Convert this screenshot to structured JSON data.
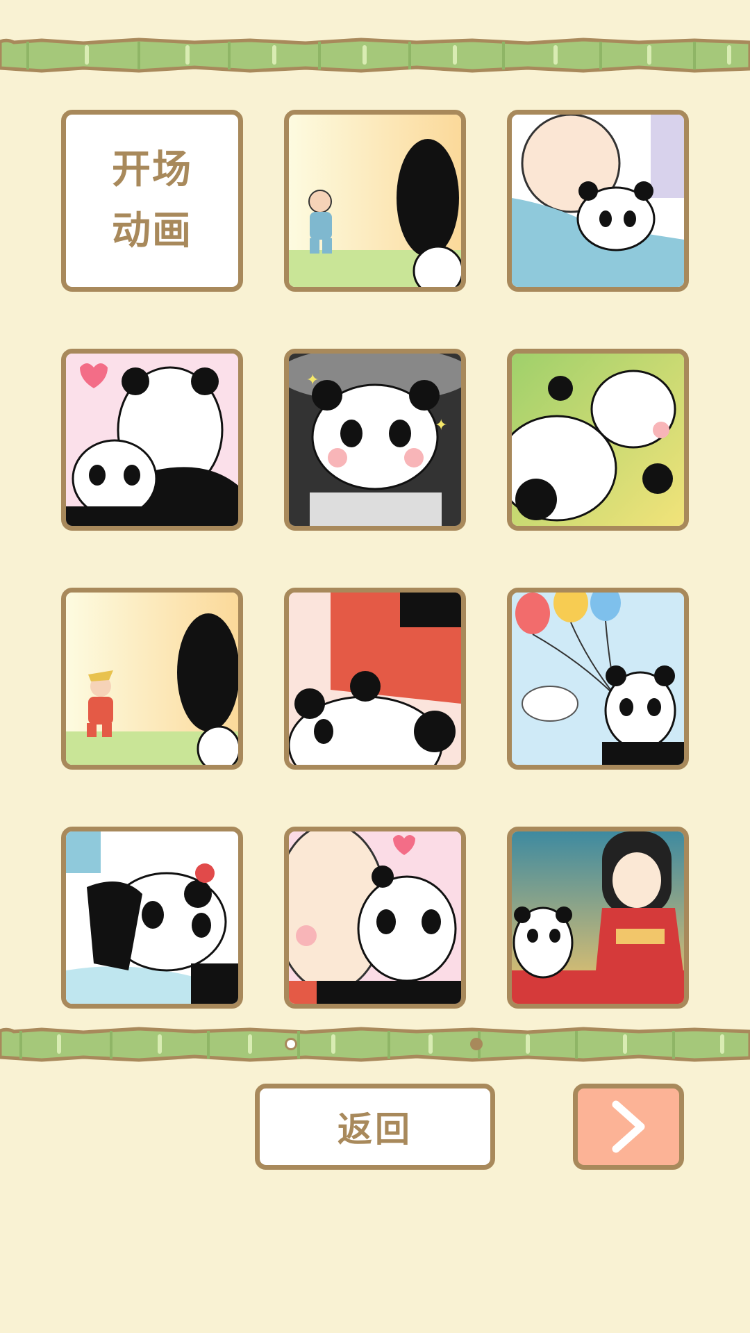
{
  "colors": {
    "background": "#f9f2d3",
    "frame": "#a8895b",
    "bamboo": "#a5c87a",
    "next_button": "#fcb396"
  },
  "gallery": {
    "opening_card_line1": "开场",
    "opening_card_line2": "动画",
    "cards": [
      {
        "icon": "grandpa-waving-thumbnail"
      },
      {
        "icon": "grandpa-hugging-panda-thumbnail"
      },
      {
        "icon": "panda-parent-and-cub-thumbnail"
      },
      {
        "icon": "panda-in-basin-thumbnail"
      },
      {
        "icon": "two-pandas-lying-thumbnail"
      },
      {
        "icon": "man-in-red-running-thumbnail"
      },
      {
        "icon": "man-in-red-with-panda-thumbnail"
      },
      {
        "icon": "panda-with-balloons-thumbnail"
      },
      {
        "icon": "panda-crying-thumbnail"
      },
      {
        "icon": "baby-kissing-panda-thumbnail"
      },
      {
        "icon": "panda-with-kimono-lady-thumbnail"
      }
    ]
  },
  "pagination": {
    "current_page": 1,
    "total_pages": 2
  },
  "buttons": {
    "back_label": "返回",
    "next_icon": "chevron-right-icon"
  }
}
